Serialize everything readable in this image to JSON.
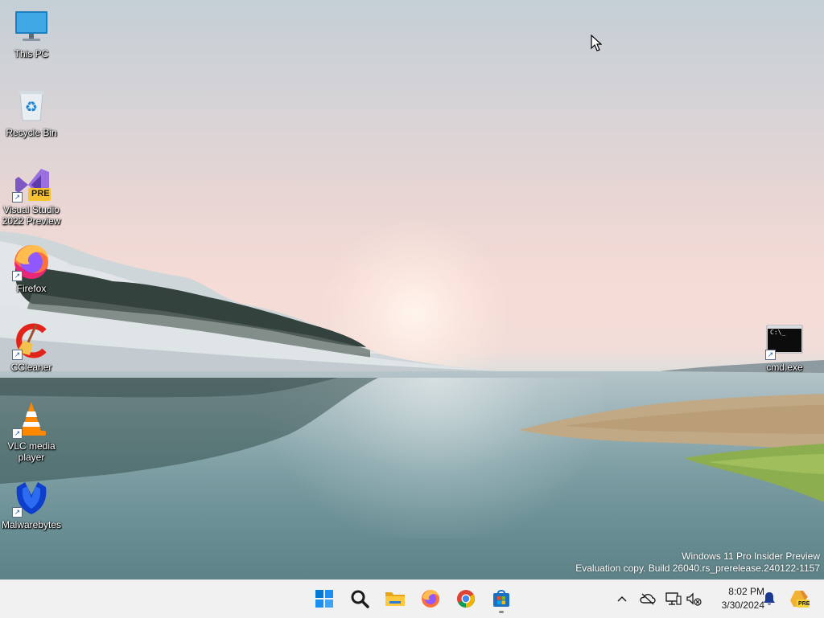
{
  "desktop": {
    "icons": [
      {
        "label": "This PC",
        "icon": "monitor-icon"
      },
      {
        "label": "Recycle Bin",
        "icon": "recycle-bin-icon"
      },
      {
        "label_line1": "Visual Studio",
        "label_line2": "2022 Preview",
        "badge": "PRE",
        "icon": "visual-studio-icon"
      },
      {
        "label": "Firefox",
        "icon": "firefox-icon"
      },
      {
        "label": "CCleaner",
        "icon": "ccleaner-icon"
      },
      {
        "label_line1": "VLC media",
        "label_line2": "player",
        "icon": "vlc-icon"
      },
      {
        "label": "Malwarebytes",
        "icon": "malwarebytes-icon"
      },
      {
        "label": "cmd.exe",
        "icon": "cmd-icon",
        "prompt": "C:\\_"
      }
    ],
    "shortcut_arrow": "↗"
  },
  "watermark": {
    "line1": "Windows 11 Pro Insider Preview",
    "line2": "Evaluation copy. Build 26040.rs_prerelease.240122-1157"
  },
  "taskbar": {
    "apps": [
      {
        "name": "Start",
        "icon": "windows-start-icon"
      },
      {
        "name": "Search",
        "icon": "search-icon"
      },
      {
        "name": "File Explorer",
        "icon": "folder-icon"
      },
      {
        "name": "Firefox",
        "icon": "firefox-icon"
      },
      {
        "name": "Chrome",
        "icon": "chrome-icon"
      },
      {
        "name": "Microsoft Store",
        "icon": "store-icon",
        "running": true
      }
    ],
    "tray": {
      "overflow_chevron": "^",
      "icons": [
        "onedrive-offline-icon",
        "display-icon",
        "network-speaker-icon"
      ],
      "time": "8:02 PM",
      "date": "3/30/2024",
      "notification_icon": "bell-icon",
      "copilot_badge": "PRE"
    }
  },
  "colors": {
    "taskbar_bg": "#f1f1f1",
    "windows_blue": "#0078d4",
    "firefox_orange": "#ff7139"
  }
}
